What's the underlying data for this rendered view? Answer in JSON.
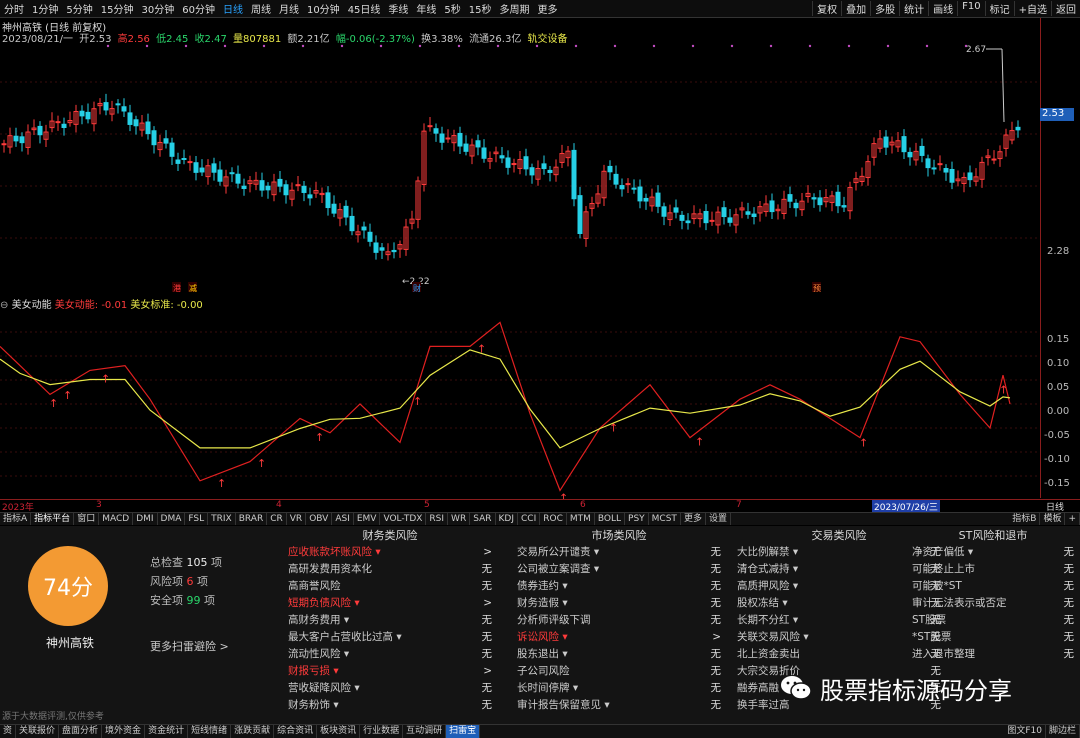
{
  "toolbar": {
    "left": [
      "分时",
      "1分钟",
      "5分钟",
      "15分钟",
      "30分钟",
      "60分钟",
      "日线",
      "周线",
      "月线",
      "10分钟",
      "45日线",
      "季线",
      "年线",
      "5秒",
      "15秒",
      "多周期",
      "更多"
    ],
    "active": "日线",
    "right": [
      "复权",
      "叠加",
      "多股",
      "统计",
      "画线",
      "F10",
      "标记",
      "+自选",
      "返回"
    ]
  },
  "stock": {
    "title": "神州高铁 (日线 前复权)",
    "date": "2023/08/21/一",
    "open": "开2.53",
    "high": "高2.56",
    "low": "低2.45",
    "close": "收2.47",
    "volume": "量807881",
    "amount": "额2.21亿",
    "change": "幅-0.06(-2.37%)",
    "turnover": "换3.38%",
    "float": "流通26.3亿",
    "settings": "轨交设备"
  },
  "price_axis": {
    "top": "2.67",
    "current": "2.53",
    "low": "2.22",
    "bottom_tick": "2.28"
  },
  "markers": [
    "港",
    "减",
    "财",
    "预"
  ],
  "indicator": {
    "name": "美女动能",
    "line1": "美女动能: -0.01",
    "line2": "美女标准: -0.00",
    "ticks": [
      "0.15",
      "0.10",
      "0.05",
      "0.00",
      "-0.05",
      "-0.10",
      "-0.15"
    ]
  },
  "date_axis": {
    "labels": [
      "2023年",
      "3",
      "4",
      "5",
      "6",
      "7"
    ],
    "cursor": "2023/07/26/三",
    "right": "日线"
  },
  "ind_tabs": [
    "指标A",
    "指标平台",
    "窗口",
    "MACD",
    "DMI",
    "DMA",
    "FSL",
    "TRIX",
    "BRAR",
    "CR",
    "VR",
    "OBV",
    "ASI",
    "EMV",
    "VOL-TDX",
    "RSI",
    "WR",
    "SAR",
    "KDJ",
    "CCI",
    "ROC",
    "MTM",
    "BOLL",
    "PSY",
    "MCST",
    "更多",
    "设置"
  ],
  "ind_tabs_right": [
    "指标B",
    "模板",
    "+"
  ],
  "scan": {
    "score": "74分",
    "name": "神州高铁",
    "total_label": "总检查",
    "total": "105",
    "total_unit": "项",
    "risk_label": "风险项",
    "risk": "6",
    "safe_label": "安全项",
    "safe": "99",
    "more": "更多扫雷避险 >",
    "disclaimer": "源于大数据评测,仅供参考"
  },
  "columns": [
    {
      "title": "财务类风险",
      "rows": [
        [
          "应收账款坏账风险 ▾",
          ">",
          true
        ],
        [
          "高研发费用资本化",
          "无",
          false
        ],
        [
          "高商誉风险",
          "无",
          false
        ],
        [
          "短期负债风险 ▾",
          ">",
          true
        ],
        [
          "高财务费用 ▾",
          "无",
          false
        ],
        [
          "最大客户占营收比过高 ▾",
          "无",
          false
        ],
        [
          "流动性风险 ▾",
          "无",
          false
        ],
        [
          "财报亏损 ▾",
          ">",
          true
        ],
        [
          "营收疑降风险 ▾",
          "无",
          false
        ],
        [
          "财务粉饰 ▾",
          "无",
          false
        ]
      ]
    },
    {
      "title": "市场类风险",
      "rows": [
        [
          "交易所公开谴责 ▾",
          "无",
          false
        ],
        [
          "公司被立案调查 ▾",
          "无",
          false
        ],
        [
          "债券违约 ▾",
          "无",
          false
        ],
        [
          "财务造假 ▾",
          "无",
          false
        ],
        [
          "分析师评级下调",
          "无",
          false
        ],
        [
          "诉讼风险 ▾",
          ">",
          true
        ],
        [
          "股东退出 ▾",
          "无",
          false
        ],
        [
          "子公司风险",
          "无",
          false
        ],
        [
          "长时间停牌 ▾",
          "无",
          false
        ],
        [
          "审计报告保留意见 ▾",
          "无",
          false
        ]
      ]
    },
    {
      "title": "交易类风险",
      "rows": [
        [
          "大比例解禁 ▾",
          "无",
          false
        ],
        [
          "清仓式减持 ▾",
          "无",
          false
        ],
        [
          "高质押风险 ▾",
          "无",
          false
        ],
        [
          "股权冻结 ▾",
          "无",
          false
        ],
        [
          "长期不分红 ▾",
          "无",
          false
        ],
        [
          "关联交易风险 ▾",
          "无",
          false
        ],
        [
          "北上资金卖出",
          "无",
          false
        ],
        [
          "大宗交易折价",
          "无",
          false
        ],
        [
          "融券高融",
          "无",
          false
        ],
        [
          "换手率过高",
          "无",
          false
        ]
      ]
    },
    {
      "title": "ST风险和退市",
      "rows": [
        [
          "净资产偏低 ▾",
          "无",
          false
        ],
        [
          "可能终止上市",
          "无",
          false
        ],
        [
          "可能被*ST",
          "无",
          false
        ],
        [
          "审计无法表示或否定",
          "无",
          false
        ],
        [
          "ST股票",
          "无",
          false
        ],
        [
          "*ST股票",
          "无",
          false
        ],
        [
          "进入退市整理",
          "无",
          false
        ]
      ]
    }
  ],
  "watermark": "股票指标源码分享",
  "footer": [
    "资",
    "关联报价",
    "盘面分析",
    "境外资金",
    "资金统计",
    "短线情绪",
    "涨跌贡献",
    "综合资讯",
    "板块资讯",
    "行业数据",
    "互动调研",
    "扫雷宝"
  ],
  "footer_active": "扫雷宝",
  "footer_right": [
    "图文F10",
    "脚边栏"
  ],
  "colors": {
    "up": "#ff3b3b",
    "down": "#26d0e6",
    "ma": "#e8e84a"
  }
}
